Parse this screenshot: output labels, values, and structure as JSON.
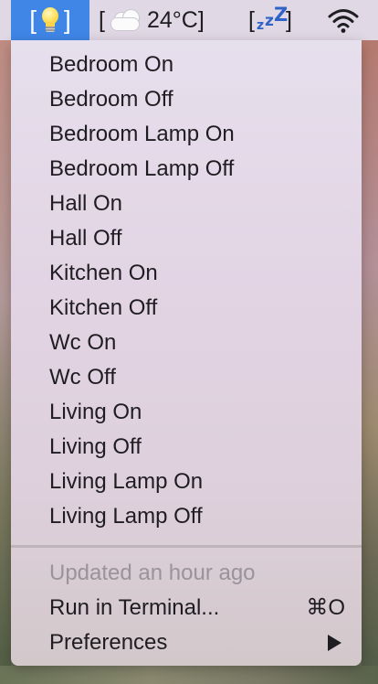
{
  "menubar": {
    "bulb_left_bracket": "[",
    "bulb_right_bracket": "]",
    "weather_left_bracket": "[",
    "weather_temp": "24°C]",
    "sleep_left_bracket": "[",
    "sleep_right_bracket": "]",
    "sleep_glyph_1": "z",
    "sleep_glyph_2": "z",
    "sleep_glyph_3": "Z",
    "icons": [
      "lightbulb-icon",
      "cloud-icon",
      "sleep-zzz-icon",
      "wifi-icon"
    ],
    "accent": "#3f86e6"
  },
  "menu": {
    "items": [
      "Bedroom On",
      "Bedroom Off",
      "Bedroom Lamp On",
      "Bedroom Lamp Off",
      "Hall On",
      "Hall Off",
      "Kitchen On",
      "Kitchen Off",
      "Wc On",
      "Wc Off",
      "Living On",
      "Living Off",
      "Living Lamp On",
      "Living Lamp Off"
    ],
    "updated": "Updated an hour ago",
    "run_in_terminal": "Run in Terminal...",
    "run_shortcut": "⌘O",
    "preferences": "Preferences"
  }
}
